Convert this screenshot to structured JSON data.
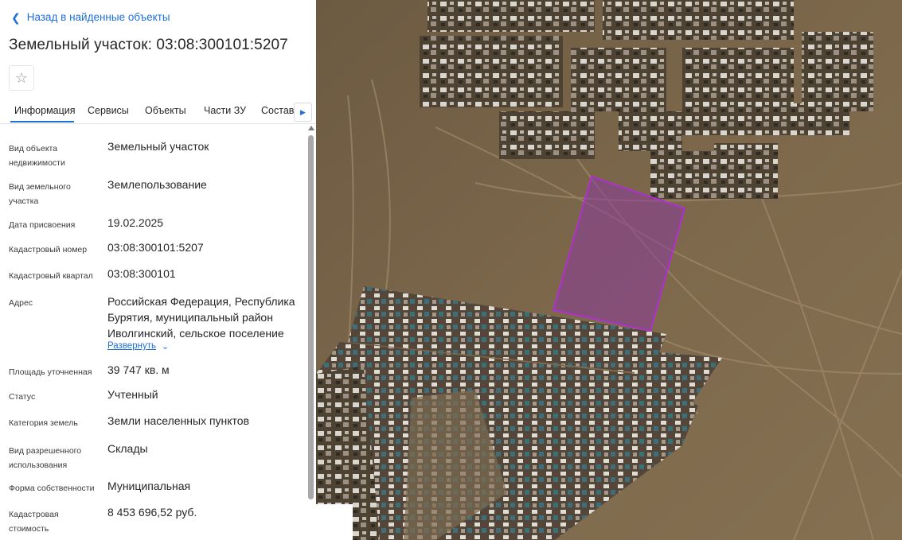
{
  "back_link": {
    "label": "Назад в найденные объекты"
  },
  "title": "Земельный участок: 03:08:300101:5207",
  "tabs": [
    {
      "label": "Информация",
      "active": true
    },
    {
      "label": "Сервисы"
    },
    {
      "label": "Объекты"
    },
    {
      "label": "Части ЗУ"
    },
    {
      "label": "Состав"
    }
  ],
  "properties": [
    {
      "label": "Вид объекта недвижимости",
      "value": "Земельный участок"
    },
    {
      "label": "Вид земельного участка",
      "value": "Землепользование"
    },
    {
      "label": "Дата присвоения",
      "value": "19.02.2025"
    },
    {
      "label": "Кадастровый номер",
      "value": "03:08:300101:5207"
    },
    {
      "label": "Кадастровый квартал",
      "value": "03:08:300101"
    },
    {
      "label": "Адрес",
      "value": "Российская Федерация, Республика Бурятия, муниципальный район Иволгинский, сельское поселение"
    },
    {
      "label": "Площадь уточненная",
      "value": "39 747 кв. м"
    },
    {
      "label": "Статус",
      "value": "Учтенный"
    },
    {
      "label": "Категория земель",
      "value": "Земли населенных пунктов"
    },
    {
      "label": "Вид разрешенного использования",
      "value": "Склады"
    },
    {
      "label": "Форма собственности",
      "value": "Муниципальная"
    },
    {
      "label": "Кадастровая стоимость",
      "value": "8 453 696,52 руб."
    }
  ],
  "expand_label": "Развернуть",
  "colors": {
    "accent": "#1e6fd9",
    "parcel_fill": "#8a3a9c",
    "parcel_stroke": "#b02fd0",
    "terrain": "#7a6549"
  },
  "icons": {
    "back": "chevron-left-icon",
    "favorite": "star-outline-icon",
    "tabs_next": "chevron-right-icon",
    "expand": "chevron-down-icon"
  }
}
